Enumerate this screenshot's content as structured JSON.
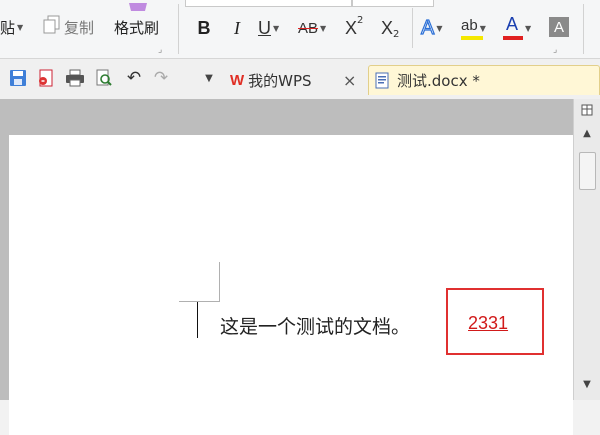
{
  "ribbon": {
    "paste_label": "贴",
    "copy_label": "复制",
    "format_painter_label": "格式刷",
    "bold": "B",
    "italic": "I",
    "underline": "U",
    "strike": "AB",
    "superscript_base": "X",
    "superscript_mark": "2",
    "subscript_base": "X",
    "subscript_mark": "2",
    "text_effect": "A",
    "highlight": "ab",
    "font_color": "A",
    "char_shading": "A"
  },
  "tabs": [
    {
      "label": "我的WPS",
      "close": "×"
    },
    {
      "label": "测试.docx *"
    }
  ],
  "document": {
    "text": "这是一个测试的文档。",
    "highlighted_number": "2331"
  },
  "colors": {
    "accent_red": "#d11a1a",
    "wps_logo": "#e02e24",
    "font_color_bar": "#e02020",
    "highlight_bar": "#f5e800",
    "active_tab_bg": "#fff7d6"
  }
}
